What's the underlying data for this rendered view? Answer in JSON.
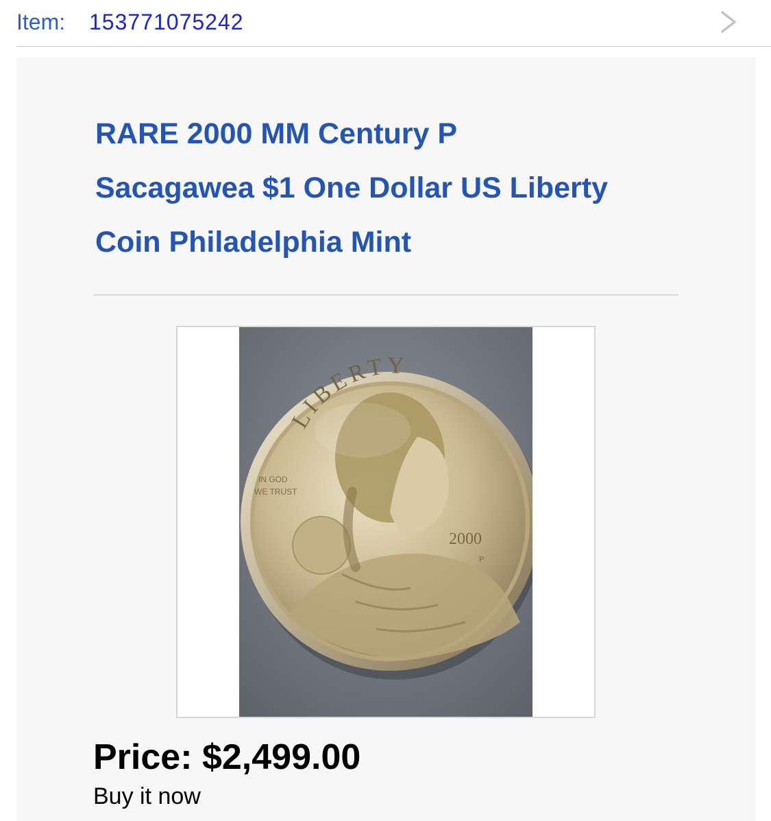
{
  "item": {
    "label": "Item:",
    "number": "153771075242",
    "chevron_icon": "chevron-right-icon"
  },
  "listing": {
    "title": "RARE 2000 MM Century P Sacagawea $1 One Dollar US Liberty Coin Philadelphia Mint",
    "image": {
      "subject": "Sacagawea dollar coin photo",
      "coin_text_liberty": "LIBERTY",
      "coin_text_motto_line1": "IN GOD",
      "coin_text_motto_line2": "WE TRUST",
      "coin_text_year": "2000",
      "coin_text_mint": "P"
    },
    "price": "Price: $2,499.00",
    "buy_format": "Buy it now"
  },
  "colors": {
    "link_blue": "#2a5fc4",
    "item_number_blue": "#1a25d6",
    "title_blue": "#2354b8",
    "card_background": "#f7f7f7"
  }
}
